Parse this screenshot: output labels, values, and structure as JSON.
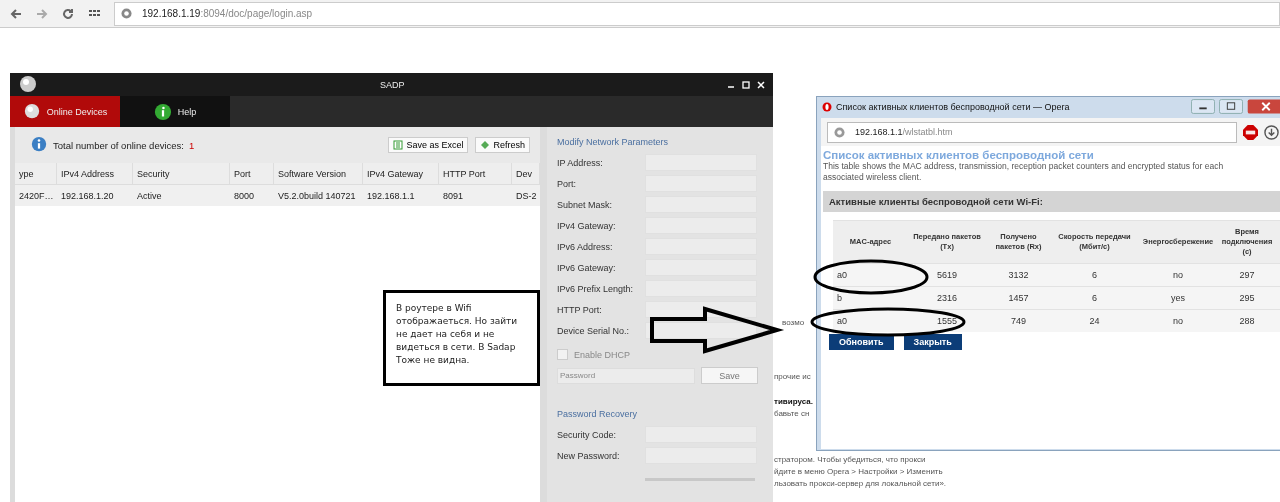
{
  "browser": {
    "url_host": "192.168.1.19",
    "url_path": ":8094/doc/page/login.asp"
  },
  "background_page": {
    "fragments": [
      {
        "text": "возмо",
        "kind": "plain"
      },
      {
        "text": "прочие ис",
        "kind": "plain"
      },
      {
        "text": "тивируса.",
        "kind": "bold"
      },
      {
        "text": "бавьте сн",
        "kind": "plain"
      },
      {
        "text": "стратором. Чтобы убедиться, что прокси",
        "kind": "plain"
      },
      {
        "text": "йдите в меню Opera > Настройки > Изменить",
        "kind": "plain"
      },
      {
        "text": "льзовать прокси-сервер для локальной сети».",
        "kind": "plain"
      }
    ]
  },
  "sadp": {
    "title": "SADP",
    "tabs": [
      {
        "label": "Online Devices",
        "selected": true
      },
      {
        "label": "Help",
        "selected": false
      }
    ],
    "total_label": "Total number of online devices:",
    "total_count": "1",
    "buttons": [
      "Save as Excel",
      "Refresh"
    ],
    "table": {
      "columns": [
        "ype",
        "IPv4 Address",
        "Security",
        "Port",
        "Software Version",
        "IPv4 Gateway",
        "HTTP Port",
        "Dev"
      ],
      "rows": [
        {
          "selected": true,
          "cells": [
            "2420F…",
            "192.168.1.20",
            "Active",
            "8000",
            "V5.2.0build 140721",
            "192.168.1.1",
            "8091",
            "DS-2"
          ]
        }
      ]
    },
    "modify": {
      "title": "Modify Network Parameters",
      "fields": [
        "IP Address:",
        "Port:",
        "Subnet Mask:",
        "IPv4 Gateway:",
        "IPv6 Address:",
        "IPv6 Gateway:",
        "IPv6 Prefix Length:",
        "HTTP Port:",
        "Device Serial No.:"
      ],
      "dhcp": {
        "label": "Enable DHCP",
        "checked": false
      },
      "password_placeholder": "Password",
      "save": "Save"
    },
    "recovery": {
      "title": "Password Recovery",
      "fields": [
        "Security Code:",
        "New Password:"
      ]
    }
  },
  "opera": {
    "title": "Список активных клиентов беспроводной сети — Opera",
    "url_host": "192.168.1.1",
    "url_path": "/wlstatbl.htm",
    "heading": "Список активных клиентов беспроводной сети",
    "description": "This table shows the MAC address, transmission, reception packet counters and encrypted status for each associated wireless client.",
    "section": "Активные клиенты беспроводной сети Wi-Fi:",
    "table": {
      "columns": [
        "MAC-адрес",
        "Передано пакетов (Tx)",
        "Получено пакетов (Rx)",
        "Скорость передачи (Мбит/с)",
        "Энергосбережение",
        "Время подключения (с)"
      ],
      "rows": [
        [
          "a0",
          "5619",
          "3132",
          "6",
          "no",
          "297"
        ],
        [
          "b",
          "2316",
          "1457",
          "6",
          "yes",
          "295"
        ],
        [
          "a0",
          "1555",
          "749",
          "24",
          "no",
          "288"
        ]
      ]
    },
    "buttons": [
      "Обновить",
      "Закрыть"
    ]
  },
  "annotation": {
    "text": "В роутере в Wifi  отображаеться. Но зайти не дает на себя и не видеться в сети. В Sadap Тоже не видна."
  }
}
